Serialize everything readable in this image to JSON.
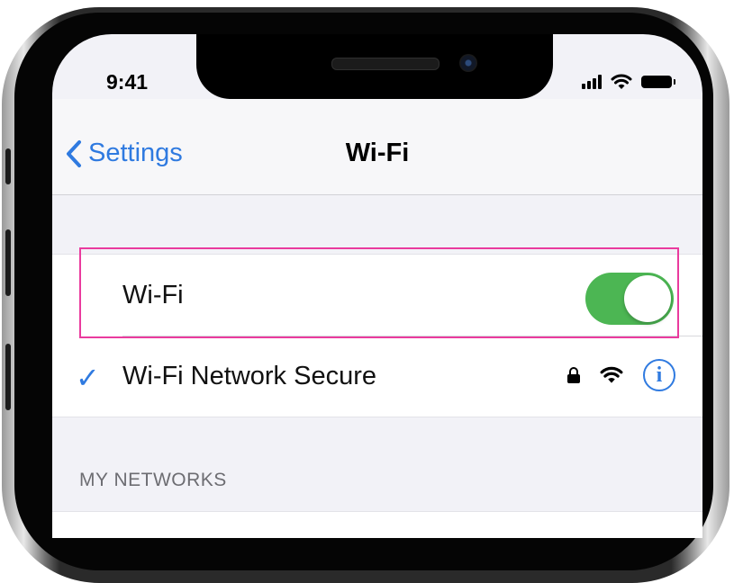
{
  "status_bar": {
    "time": "9:41",
    "icons": [
      "cellular-signal-icon",
      "wifi-icon",
      "battery-icon"
    ]
  },
  "nav": {
    "back_label": "Settings",
    "back_icon": "chevron-left-icon",
    "title": "Wi-Fi"
  },
  "wifi_toggle": {
    "label": "Wi-Fi",
    "on": true
  },
  "connected_network": {
    "name": "Wi-Fi Network Secure",
    "selected": true,
    "icons": [
      "checkmark-icon",
      "lock-icon",
      "wifi-signal-icon",
      "info-icon"
    ]
  },
  "my_networks": {
    "header": "MY NETWORKS"
  },
  "colors": {
    "accent": "#2f7ae0",
    "toggle_on": "#4cb653",
    "highlight": "#ea3b9e",
    "background": "#f2f2f7"
  }
}
